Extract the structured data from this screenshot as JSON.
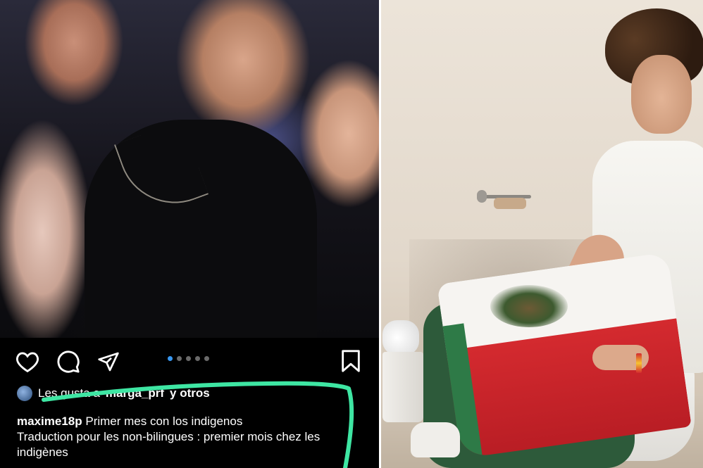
{
  "post": {
    "likes_prefix": "Les gusta a",
    "likes_user": "marga_prf",
    "likes_suffix": "y otros",
    "username": "maxime18p",
    "caption_text": "Primer mes con los indigenos",
    "translation": "Traduction pour les non-bilingues : premier mois chez les indigènes",
    "carousel": {
      "total": 5,
      "active_index": 0
    }
  },
  "icons": {
    "like": "heart-icon",
    "comment": "comment-bubble-icon",
    "share": "paper-plane-share-icon",
    "save": "bookmark-icon"
  },
  "colors": {
    "highlight": "#3ee6a3",
    "carousel_active": "#3897f0",
    "ig_background": "#000000"
  }
}
